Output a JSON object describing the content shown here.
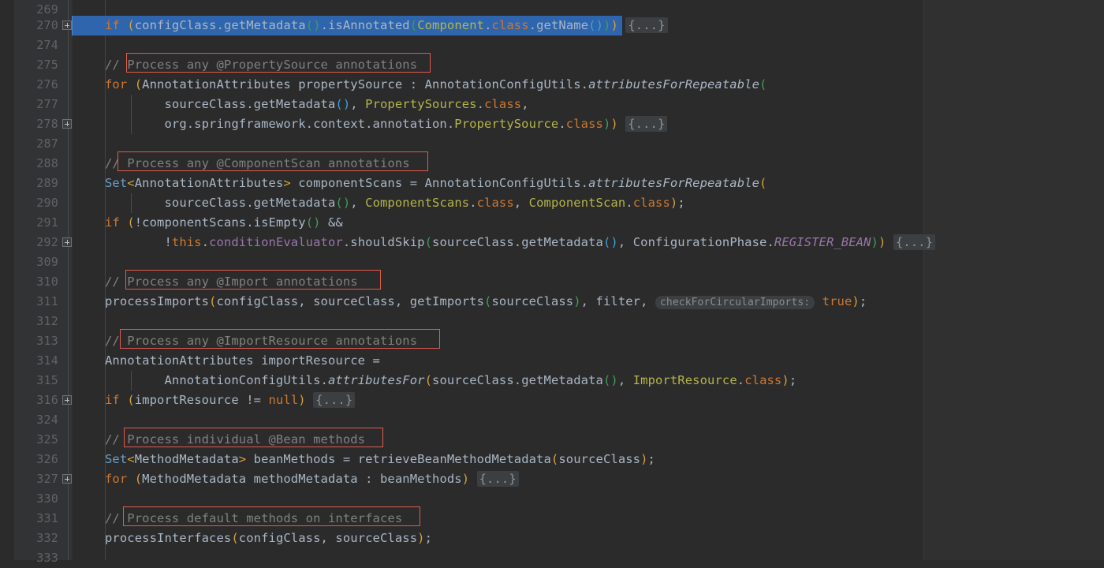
{
  "editor": {
    "language": "java",
    "theme": "darcula",
    "background": "#2b2b2b",
    "gutter_background": "#313335",
    "selection_color": "#2f65ad",
    "annotation_color": "#e05b4b",
    "comment_color": "#808080",
    "keyword_color": "#cc7832",
    "field_color": "#9876aa",
    "type_color": "#6a9ec5",
    "class_literal_color": "#b5b54a",
    "text_color": "#a9b7c6"
  },
  "lines": [
    {
      "no": "269",
      "text": "",
      "fold": false,
      "selected": false
    },
    {
      "no": "270",
      "text": "if (configClass.getMetadata().isAnnotated(Component.class.getName())) {...}",
      "fold": true,
      "selected": true
    },
    {
      "no": "274",
      "text": "",
      "fold": false,
      "selected": false
    },
    {
      "no": "275",
      "text": "// Process any @PropertySource annotations",
      "fold": false,
      "selected": false,
      "annotated": true
    },
    {
      "no": "276",
      "text": "for (AnnotationAttributes propertySource : AnnotationConfigUtils.attributesForRepeatable(",
      "fold": false,
      "selected": false
    },
    {
      "no": "277",
      "text": "        sourceClass.getMetadata(), PropertySources.class,",
      "fold": false,
      "selected": false
    },
    {
      "no": "278",
      "text": "        org.springframework.context.annotation.PropertySource.class)) {...}",
      "fold": true,
      "selected": false
    },
    {
      "no": "287",
      "text": "",
      "fold": false,
      "selected": false
    },
    {
      "no": "288",
      "text": "// Process any @ComponentScan annotations",
      "fold": false,
      "selected": false,
      "annotated": true
    },
    {
      "no": "289",
      "text": "Set<AnnotationAttributes> componentScans = AnnotationConfigUtils.attributesForRepeatable(",
      "fold": false,
      "selected": false
    },
    {
      "no": "290",
      "text": "        sourceClass.getMetadata(), ComponentScans.class, ComponentScan.class);",
      "fold": false,
      "selected": false
    },
    {
      "no": "291",
      "text": "if (!componentScans.isEmpty() &&",
      "fold": false,
      "selected": false
    },
    {
      "no": "292",
      "text": "        !this.conditionEvaluator.shouldSkip(sourceClass.getMetadata(), ConfigurationPhase.REGISTER_BEAN)) {...}",
      "fold": true,
      "selected": false
    },
    {
      "no": "309",
      "text": "",
      "fold": false,
      "selected": false
    },
    {
      "no": "310",
      "text": "// Process any @Import annotations",
      "fold": false,
      "selected": false,
      "annotated": true
    },
    {
      "no": "311",
      "text": "processImports(configClass, sourceClass, getImports(sourceClass), filter,  checkForCircularImports: true);",
      "fold": false,
      "selected": false
    },
    {
      "no": "312",
      "text": "",
      "fold": false,
      "selected": false
    },
    {
      "no": "313",
      "text": "// Process any @ImportResource annotations",
      "fold": false,
      "selected": false,
      "annotated": true
    },
    {
      "no": "314",
      "text": "AnnotationAttributes importResource =",
      "fold": false,
      "selected": false
    },
    {
      "no": "315",
      "text": "        AnnotationConfigUtils.attributesFor(sourceClass.getMetadata(), ImportResource.class);",
      "fold": false,
      "selected": false
    },
    {
      "no": "316",
      "text": "if (importResource != null) {...}",
      "fold": true,
      "selected": false
    },
    {
      "no": "324",
      "text": "",
      "fold": false,
      "selected": false
    },
    {
      "no": "325",
      "text": "// Process individual @Bean methods",
      "fold": false,
      "selected": false,
      "annotated": true
    },
    {
      "no": "326",
      "text": "Set<MethodMetadata> beanMethods = retrieveBeanMethodMetadata(sourceClass);",
      "fold": false,
      "selected": false
    },
    {
      "no": "327",
      "text": "for (MethodMetadata methodMetadata : beanMethods) {...}",
      "fold": true,
      "selected": false
    },
    {
      "no": "330",
      "text": "",
      "fold": false,
      "selected": false
    },
    {
      "no": "331",
      "text": "// Process default methods on interfaces",
      "fold": false,
      "selected": false,
      "annotated": true
    },
    {
      "no": "332",
      "text": "processInterfaces(configClass, sourceClass);",
      "fold": false,
      "selected": false
    },
    {
      "no": "333",
      "text": "",
      "fold": false,
      "selected": false
    }
  ],
  "annotations": [
    {
      "label": "// Process any @PropertySource annotations",
      "line": "275"
    },
    {
      "label": "// Process any @ComponentScan annotations",
      "line": "288"
    },
    {
      "label": "// Process any @Import annotations",
      "line": "310"
    },
    {
      "label": "// Process any @ImportResource annotations",
      "line": "313"
    },
    {
      "label": "// Process individual @Bean methods",
      "line": "325"
    },
    {
      "label": "// Process default methods on interfaces",
      "line": "331"
    }
  ],
  "inlay_hints": [
    {
      "line": "311",
      "label": "checkForCircularImports:",
      "value": "true"
    }
  ],
  "fold_placeholder": "{...}"
}
